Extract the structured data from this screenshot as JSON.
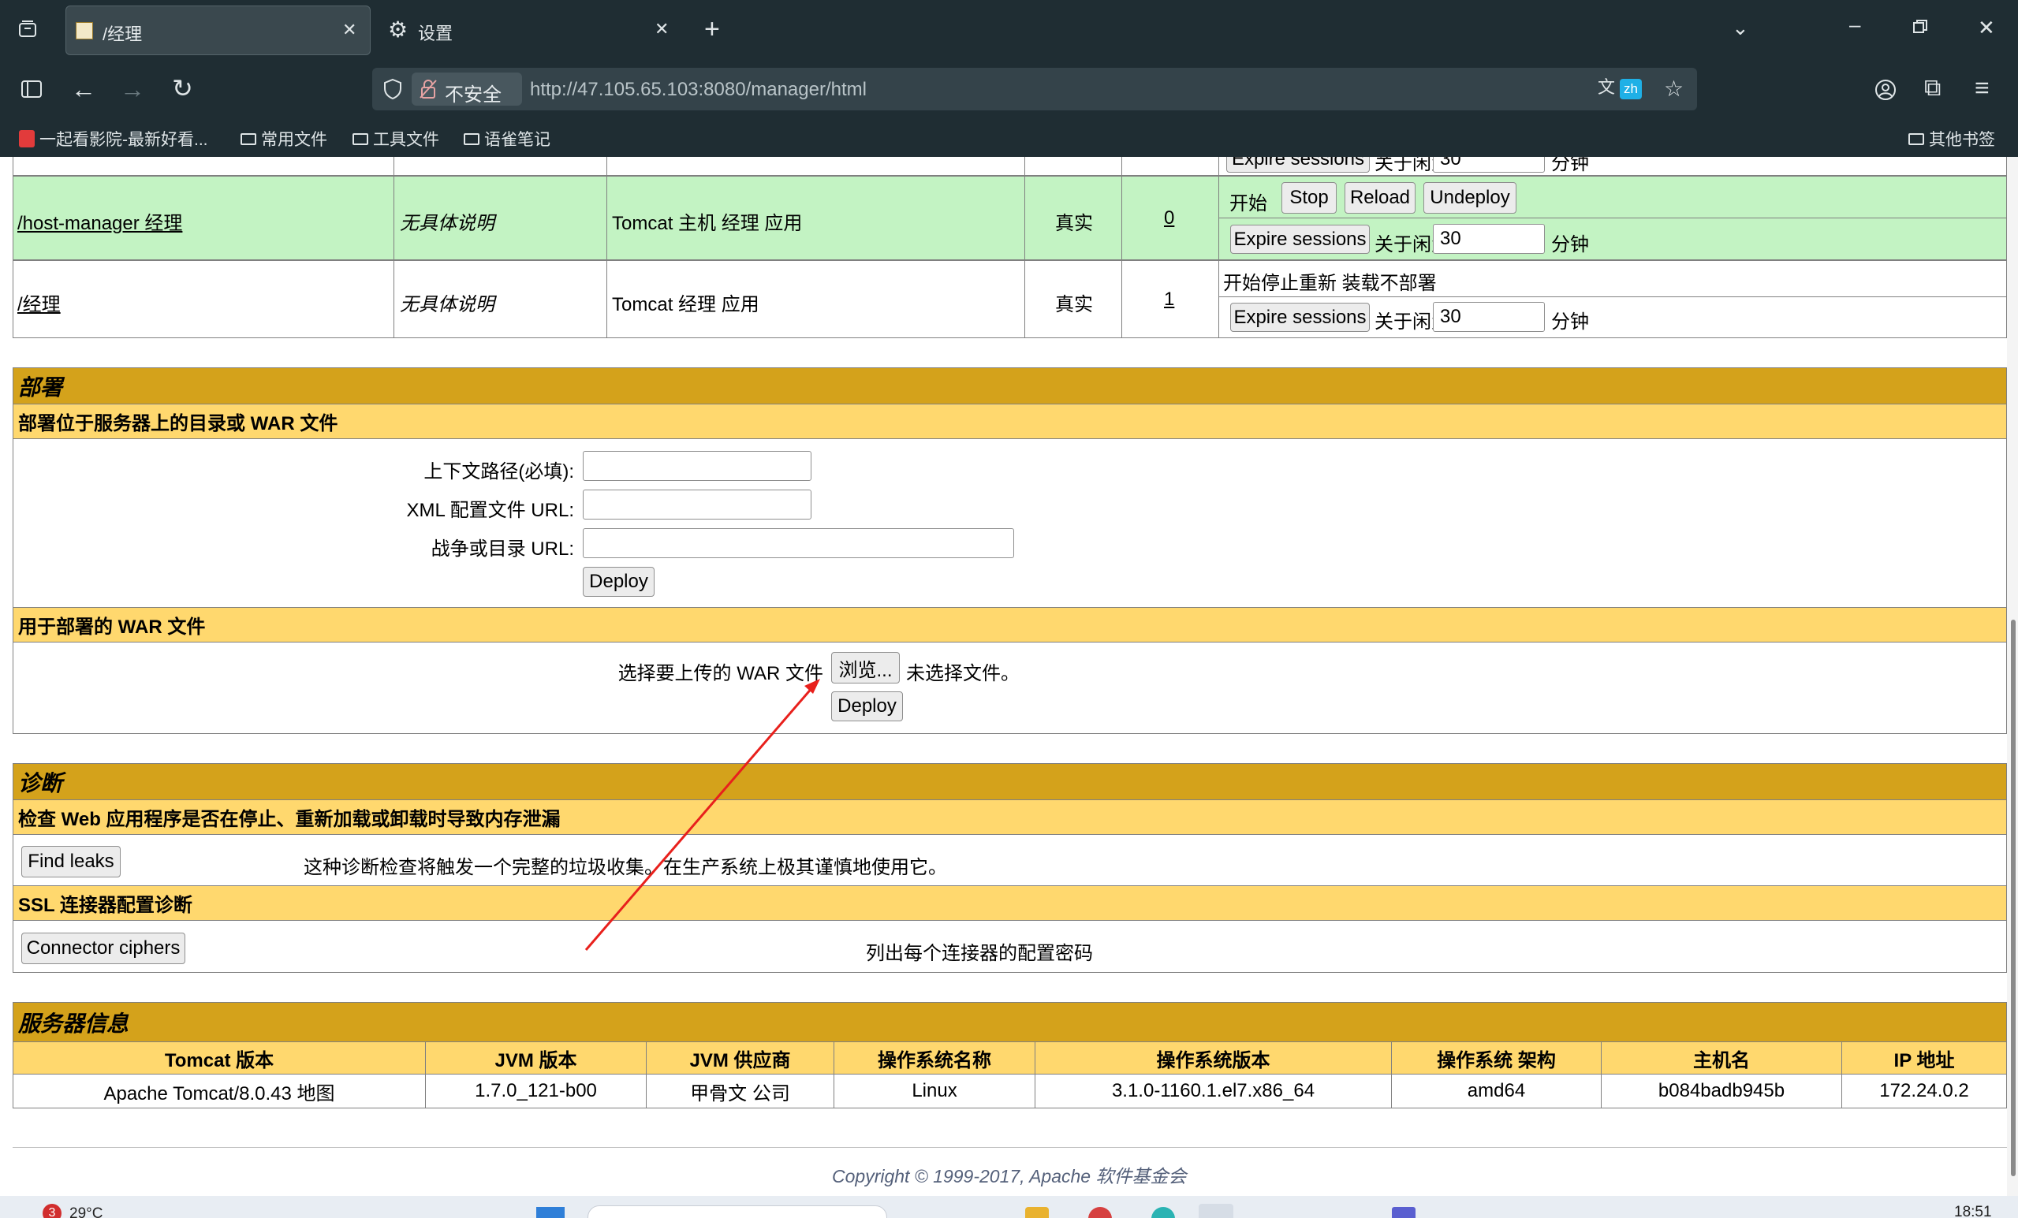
{
  "browser": {
    "tabs": [
      {
        "title": "/经理",
        "active": true
      },
      {
        "title": "设置",
        "active": false
      }
    ],
    "security_label": "不安全",
    "url": "http://47.105.65.103:8080/manager/html",
    "translate_badge": "zh",
    "bookmarks": [
      "一起看影院-最新好看...",
      "常用文件",
      "工具文件",
      "语雀笔记"
    ],
    "other_bookmarks": "其他书签"
  },
  "apps": {
    "partial_row": {
      "expire_label": "Expire sessions",
      "idle_label": "关于闲置≥",
      "idle_value": "30",
      "unit": "分钟"
    },
    "rows": [
      {
        "path": "/host-manager 经理",
        "version": "无具体说明",
        "display_name": "Tomcat 主机 经理 应用",
        "running": "真实",
        "sessions": "0",
        "commands_start": "开始",
        "buttons": [
          "Stop",
          "Reload",
          "Undeploy"
        ],
        "expire_label": "Expire sessions",
        "idle_label": "关于闲置≥",
        "idle_value": "30",
        "unit": "分钟"
      },
      {
        "path": "/经理",
        "version": "无具体说明",
        "display_name": "Tomcat 经理 应用",
        "running": "真实",
        "sessions": "1",
        "commands_text": "开始停止重新 装载不部署",
        "expire_label": "Expire sessions",
        "idle_label": "关于闲置≥",
        "idle_value": "30",
        "unit": "分钟"
      }
    ]
  },
  "deploy": {
    "title": "部署",
    "dir_subtitle": "部署位于服务器上的目录或 WAR 文件",
    "context_path_label": "上下文路径(必填):",
    "xml_url_label": "XML 配置文件 URL:",
    "war_url_label": "战争或目录 URL:",
    "deploy_label": "Deploy",
    "war_subtitle": "用于部署的 WAR 文件",
    "choose_label": "选择要上传的 WAR 文件",
    "browse_label": "浏览...",
    "no_file_label": "未选择文件。",
    "deploy2_label": "Deploy"
  },
  "diagnostics": {
    "title": "诊断",
    "leak_subtitle": "检查 Web 应用程序是否在停止、重新加载或卸载时导致内存泄漏",
    "find_leaks_label": "Find leaks",
    "leak_desc": "这种诊断检查将触发一个完整的垃圾收集。在生产系统上极其谨慎地使用它。",
    "ssl_subtitle": "SSL 连接器配置诊断",
    "ciphers_label": "Connector ciphers",
    "ciphers_desc": "列出每个连接器的配置密码"
  },
  "server_info": {
    "title": "服务器信息",
    "headers": [
      "Tomcat 版本",
      "JVM 版本",
      "JVM 供应商",
      "操作系统名称",
      "操作系统版本",
      "操作系统 架构",
      "主机名",
      "IP 地址"
    ],
    "values": [
      "Apache Tomcat/8.0.43 地图",
      "1.7.0_121-b00",
      "甲骨文 公司",
      "Linux",
      "3.1.0-1160.1.el7.x86_64",
      "amd64",
      "b084badb945b",
      "172.24.0.2"
    ]
  },
  "footer": {
    "copyright": "Copyright © 1999-2017, Apache 软件基金会"
  },
  "taskbar": {
    "weather": "29°C",
    "badge": "3",
    "clock": "18:51"
  },
  "colors": {
    "section_title": "#d4a21b",
    "section_sub": "#ffd86e",
    "running_row": "#c3f3c3",
    "annotation_arrow": "#e8201c"
  }
}
